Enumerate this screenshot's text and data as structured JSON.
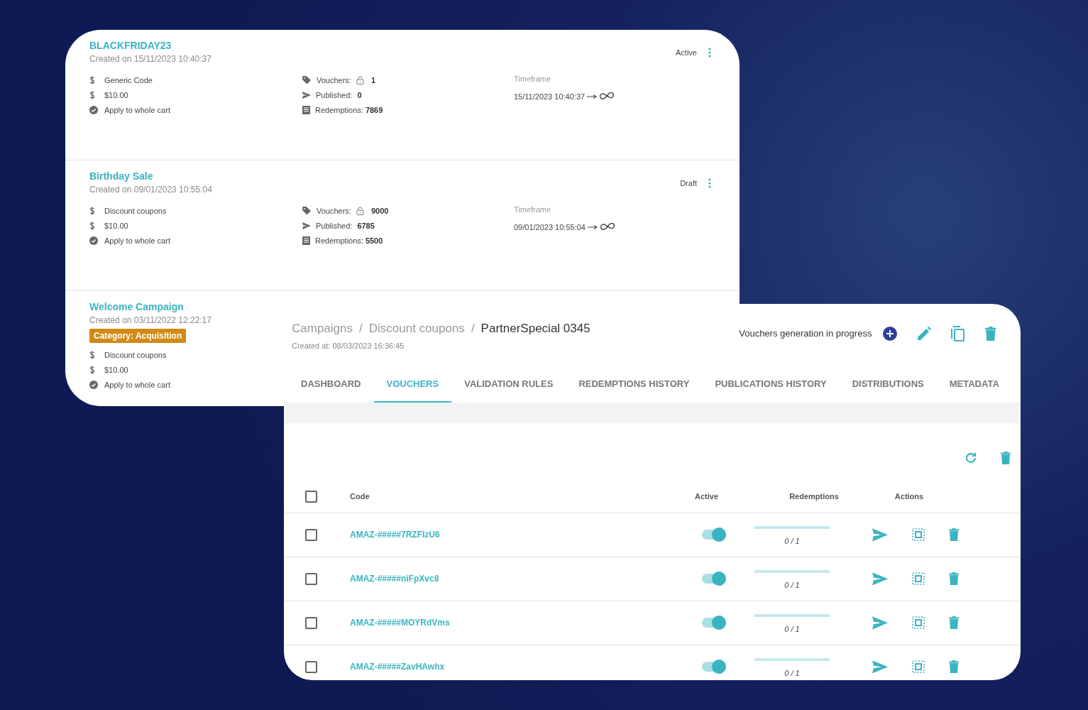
{
  "campaigns": [
    {
      "name": "BLACKFRIDAY23",
      "created": "Created on 15/11/2023 10:40:37",
      "status": "Active",
      "details": [
        "Generic Code",
        "$10.00",
        "Apply to whole cart"
      ],
      "vouchers_label": "Vouchers:",
      "vouchers": "1",
      "published_label": "Published:",
      "published": "0",
      "redemptions_label": "Redemptions:",
      "redemptions": "7869",
      "timeframe_label": "Timeframe",
      "timeframe_start": "15/11/2023 10:40:37"
    },
    {
      "name": "Birthday Sale",
      "created": "Created on 09/01/2023 10:55:04",
      "status": "Draft",
      "details": [
        "Discount coupons",
        "$10.00",
        "Apply to whole cart"
      ],
      "vouchers_label": "Vouchers:",
      "vouchers": "9000",
      "published_label": "Published:",
      "published": "6785",
      "redemptions_label": "Redemptions:",
      "redemptions": "5500",
      "timeframe_label": "Timeframe",
      "timeframe_start": "09/01/2023 10:55:04"
    },
    {
      "name": "Welcome Campaign",
      "created": "Created on 03/11/2022 12:22:17",
      "category": "Category: Acquisition",
      "details": [
        "Discount coupons",
        "$10.00",
        "Apply to whole cart"
      ]
    }
  ],
  "detail": {
    "breadcrumb": [
      {
        "kind": "link",
        "text": "Campaigns"
      },
      {
        "kind": "separator",
        "text": "/"
      },
      {
        "kind": "link",
        "text": "Discount coupons"
      },
      {
        "kind": "separator",
        "text": "/"
      },
      {
        "kind": "current",
        "text": "PartnerSpecial 0345"
      }
    ],
    "created": "Created at: 08/03/2023 16:36:45",
    "status": "Vouchers generation in progress",
    "tabs": [
      {
        "label": "DASHBOARD",
        "selected": false
      },
      {
        "label": "VOUCHERS",
        "selected": true
      },
      {
        "label": "VALIDATION RULES",
        "selected": false
      },
      {
        "label": "REDEMPTIONS HISTORY",
        "selected": false
      },
      {
        "label": "PUBLICATIONS HISTORY",
        "selected": false
      },
      {
        "label": "DISTRIBUTIONS",
        "selected": false
      },
      {
        "label": "METADATA",
        "selected": false
      }
    ],
    "table": {
      "select_all_checked": false,
      "columns": [
        "Code",
        "Active",
        "Redemptions",
        "Actions"
      ],
      "rows": [
        {
          "checked": false,
          "code": "AMAZ-#####7RZFlzU6",
          "active": true,
          "level": 0,
          "redemptions": "0 / 1"
        },
        {
          "checked": false,
          "code": "AMAZ-#####niFpXvc8",
          "active": true,
          "level": 0,
          "redemptions": "0 / 1"
        },
        {
          "checked": false,
          "code": "AMAZ-#####MOYRdVms",
          "active": true,
          "level": 0,
          "redemptions": "0 / 1"
        },
        {
          "checked": false,
          "code": "AMAZ-#####ZavHAwhx",
          "active": true,
          "level": 0,
          "redemptions": "0 / 1"
        }
      ]
    }
  }
}
